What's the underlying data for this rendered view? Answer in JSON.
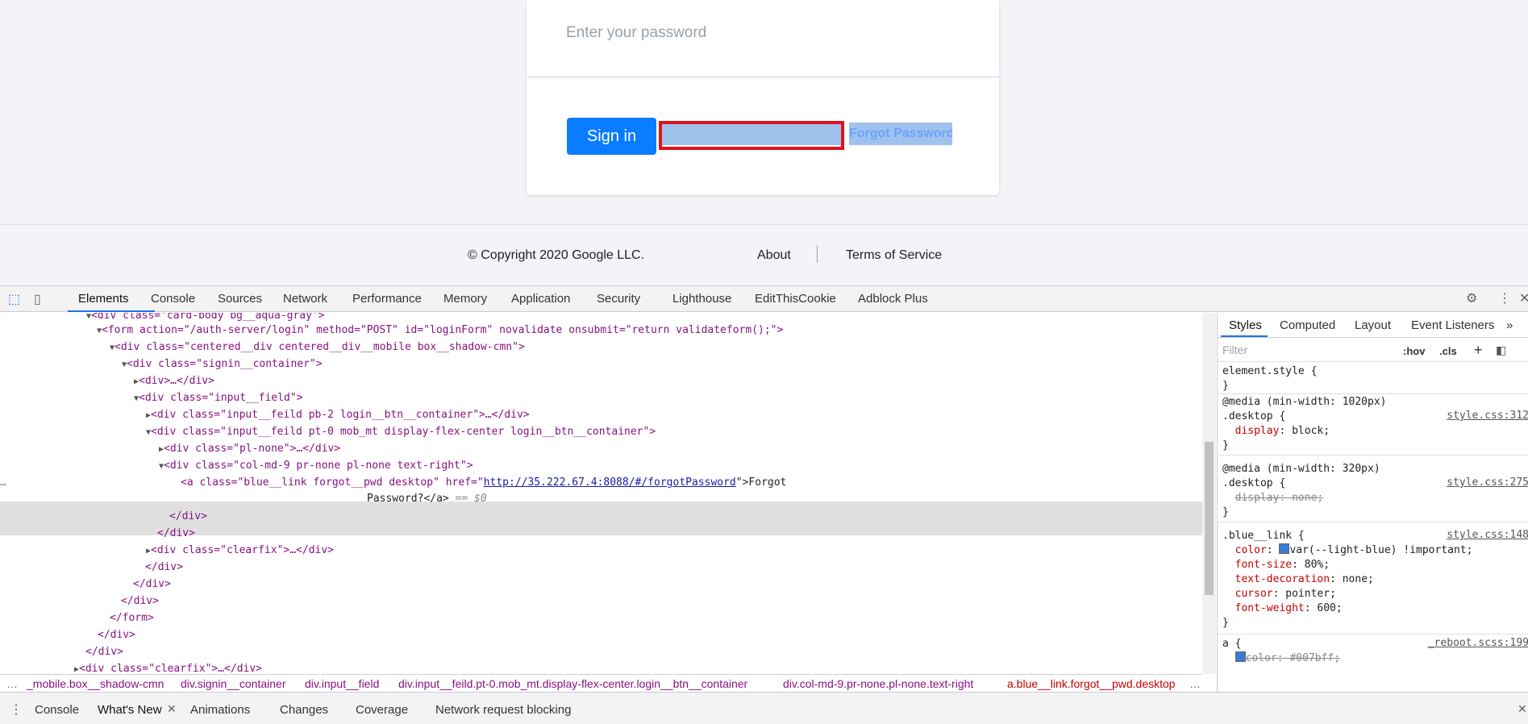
{
  "login": {
    "password_placeholder": "Enter your password",
    "signin_label": "Sign in",
    "forgot_label": "Forgot Password?"
  },
  "footer": {
    "copyright": "© Copyright 2020 Google LLC.",
    "about": "About",
    "terms": "Terms of Service"
  },
  "devtools": {
    "tabs": [
      "Elements",
      "Console",
      "Sources",
      "Network",
      "Performance",
      "Memory",
      "Application",
      "Security",
      "Lighthouse",
      "EditThisCookie",
      "Adblock Plus"
    ],
    "active_tab": "Elements",
    "right_tabs": [
      "Styles",
      "Computed",
      "Layout",
      "Event Listeners"
    ],
    "filter_placeholder": "Filter",
    "hov": ":hov",
    "cls": ".cls",
    "code": {
      "l0": "<div class=\"card-body bg__aqua-gray\">",
      "l1_open": "<form action=\"/auth-server/login\" method=\"POST\" id=\"loginForm\" novalidate onsubmit=\"return validateform();\">",
      "l2": "<div class=\"centered__div centered__div__mobile box__shadow-cmn\">",
      "l3": "<div class=\"signin__container\">",
      "l4": "<div>…</div>",
      "l5": "<div class=\"input__field\">",
      "l6": "<div class=\"input__feild pb-2 login__btn__container\">…</div>",
      "l7": "<div class=\"input__feild pt-0 mob_mt display-flex-center login__btn__container\">",
      "l8": "<div class=\"pl-none\">…</div>",
      "l9": "<div class=\"col-md-9 pr-none pl-none text-right\">",
      "l10_a": "<a class=\"blue__link forgot__pwd desktop\" href=\"",
      "l10_href": "http://35.222.67.4:8088/#/forgotPassword",
      "l10_b": "\">Forgot",
      "l11_a": "Password?</a>",
      "l11_b": " == $0",
      "l12": "</div>",
      "l13": "</div>",
      "l14": "<div class=\"clearfix\">…</div>",
      "l15": "</div>",
      "l16": "</div>",
      "l17": "</div>",
      "l18": "</form>",
      "l19": "</div>",
      "l20": "</div>",
      "l21": "<div class=\"clearfix\">…</div>"
    },
    "styles": {
      "element_style": "element.style {",
      "close": "}",
      "media1": "@media (min-width: 1020px)",
      "sel1": ".desktop {",
      "src1": "style.css:312",
      "prop1": "display",
      "val1": "block;",
      "media2": "@media (min-width: 320px)",
      "sel2": ".desktop {",
      "src2": "style.css:275",
      "prop2": "display: none;",
      "sel3": ".blue__link {",
      "src3": "style.css:148",
      "p3a": "color",
      "v3a": "var(--light-blue) !important;",
      "p3b": "font-size",
      "v3b": "80%;",
      "p3c": "text-decoration",
      "v3c": "none;",
      "p3d": "cursor",
      "v3d": "pointer;",
      "p3e": "font-weight",
      "v3e": "600;",
      "sel4": "a {",
      "src4": "_reboot.scss:199",
      "p4a": "color: #007bff;"
    },
    "breadcrumbs": [
      "_mobile.box__shadow-cmn",
      "div.signin__container",
      "div.input__field",
      "div.input__feild.pt-0.mob_mt.display-flex-center.login__btn__container",
      "div.col-md-9.pr-none.pl-none.text-right",
      "a.blue__link.forgot__pwd.desktop"
    ],
    "drawer_tabs": [
      "Console",
      "What's New",
      "Animations",
      "Changes",
      "Coverage",
      "Network request blocking"
    ]
  }
}
